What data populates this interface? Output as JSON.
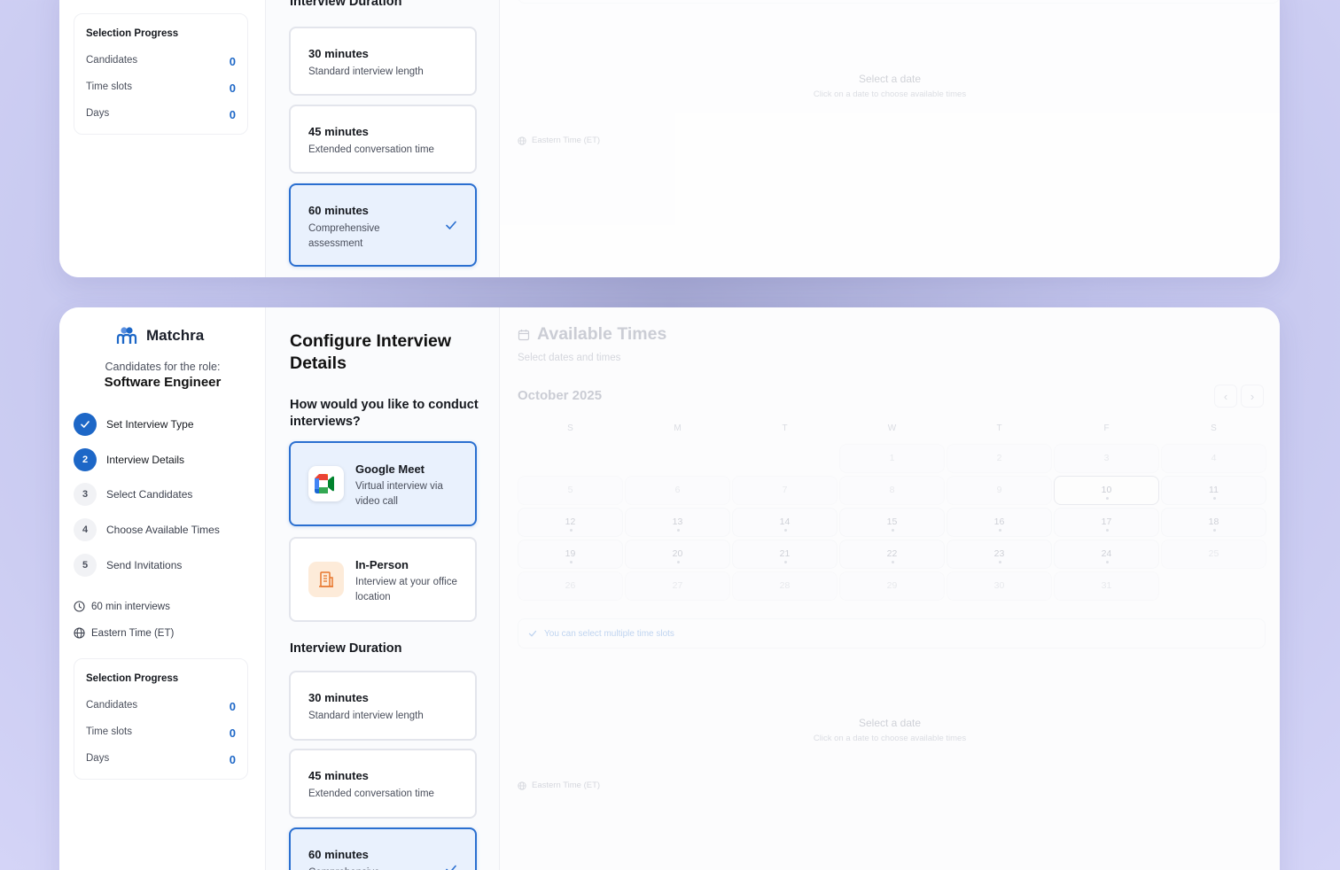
{
  "app": {
    "brand_name": "Matchra"
  },
  "role": {
    "caption": "Candidates for the role:",
    "title": "Software Engineer"
  },
  "steps": [
    {
      "number": "1",
      "label": "Set Interview Type",
      "state": "done"
    },
    {
      "number": "2",
      "label": "Interview Details",
      "state": "active"
    },
    {
      "number": "3",
      "label": "Select Candidates",
      "state": "todo"
    },
    {
      "number": "4",
      "label": "Choose Available Times",
      "state": "todo"
    },
    {
      "number": "5",
      "label": "Send Invitations",
      "state": "todo"
    }
  ],
  "meta": {
    "duration": "60 min interviews",
    "timezone": "Eastern Time (ET)"
  },
  "progress": {
    "title": "Selection Progress",
    "rows": [
      {
        "label": "Candidates",
        "value": "0"
      },
      {
        "label": "Time slots",
        "value": "0"
      },
      {
        "label": "Days",
        "value": "0"
      }
    ]
  },
  "config": {
    "title": "Configure Interview Details",
    "question": "How would you like to conduct interviews?",
    "methods": [
      {
        "title": "Google Meet",
        "desc": "Virtual interview via video call",
        "icon": "google-meet-icon",
        "selected": true
      },
      {
        "title": "In-Person",
        "desc": "Interview at your office location",
        "icon": "building-icon",
        "selected": false
      }
    ],
    "duration_title": "Interview Duration",
    "durations": [
      {
        "title": "30 minutes",
        "desc": "Standard interview length",
        "selected": false
      },
      {
        "title": "45 minutes",
        "desc": "Extended conversation time",
        "selected": false
      },
      {
        "title": "60 minutes",
        "desc": "Comprehensive assessment",
        "selected": true
      }
    ]
  },
  "times": {
    "title": "Available Times",
    "subtitle": "Select dates and times",
    "month": "October 2025",
    "weekdays": [
      "S",
      "M",
      "T",
      "W",
      "T",
      "F",
      "S"
    ],
    "weeks": [
      [
        "",
        "",
        "",
        "1",
        "2",
        "3",
        "4"
      ],
      [
        "5",
        "6",
        "7",
        "8",
        "9",
        "10",
        "11"
      ],
      [
        "12",
        "13",
        "14",
        "15",
        "16",
        "17",
        "18"
      ],
      [
        "19",
        "20",
        "21",
        "22",
        "23",
        "24",
        "25"
      ],
      [
        "26",
        "27",
        "28",
        "29",
        "30",
        "31",
        ""
      ]
    ],
    "highlighted_day": "10",
    "multi_note": "You can select multiple time slots",
    "select_date": "Select a date",
    "select_date_sub": "Click on a date to choose available times",
    "timezone": "Eastern Time (ET)"
  },
  "colors": {
    "accent": "#1d67c7",
    "selected_bg": "#e9f1fd",
    "selected_border": "#2a6fd0",
    "page_bg": "#c2c4ec"
  }
}
